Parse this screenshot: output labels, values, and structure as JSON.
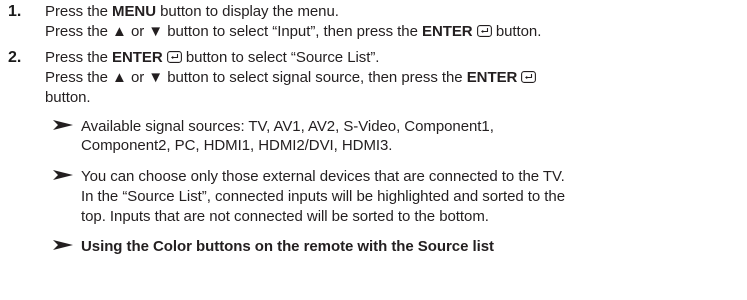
{
  "steps": [
    {
      "number": "1.",
      "line1": {
        "pre": "Press the ",
        "bold": "MENU",
        "post": " button to display the menu."
      },
      "line2": {
        "pre": "Press the ▲ or ▼ button to select “Input”, then press the ",
        "bold": "ENTER",
        "post": " button."
      }
    },
    {
      "number": "2.",
      "line1": {
        "pre": "Press the ",
        "bold": "ENTER",
        "post": " button to select “Source List”."
      },
      "line2": {
        "pre": "Press the ▲ or ▼ button to select signal source, then press the ",
        "bold": "ENTER"
      },
      "line3": "button."
    }
  ],
  "notes": [
    {
      "lines": [
        "Available signal sources: TV, AV1, AV2, S-Video, Component1,",
        "Component2, PC, HDMI1, HDMI2/DVI, HDMI3."
      ]
    },
    {
      "lines": [
        "You can choose only those external devices that are connected to the TV.",
        "In the “Source List”, connected inputs will be highlighted and sorted to the",
        "top. Inputs that are not connected will be sorted to the bottom."
      ]
    },
    {
      "lines": [
        "Using the Color buttons on the remote with the Source list"
      ]
    }
  ],
  "icons": {
    "enter": "enter-icon",
    "note_arrow": "note-arrow-icon"
  }
}
